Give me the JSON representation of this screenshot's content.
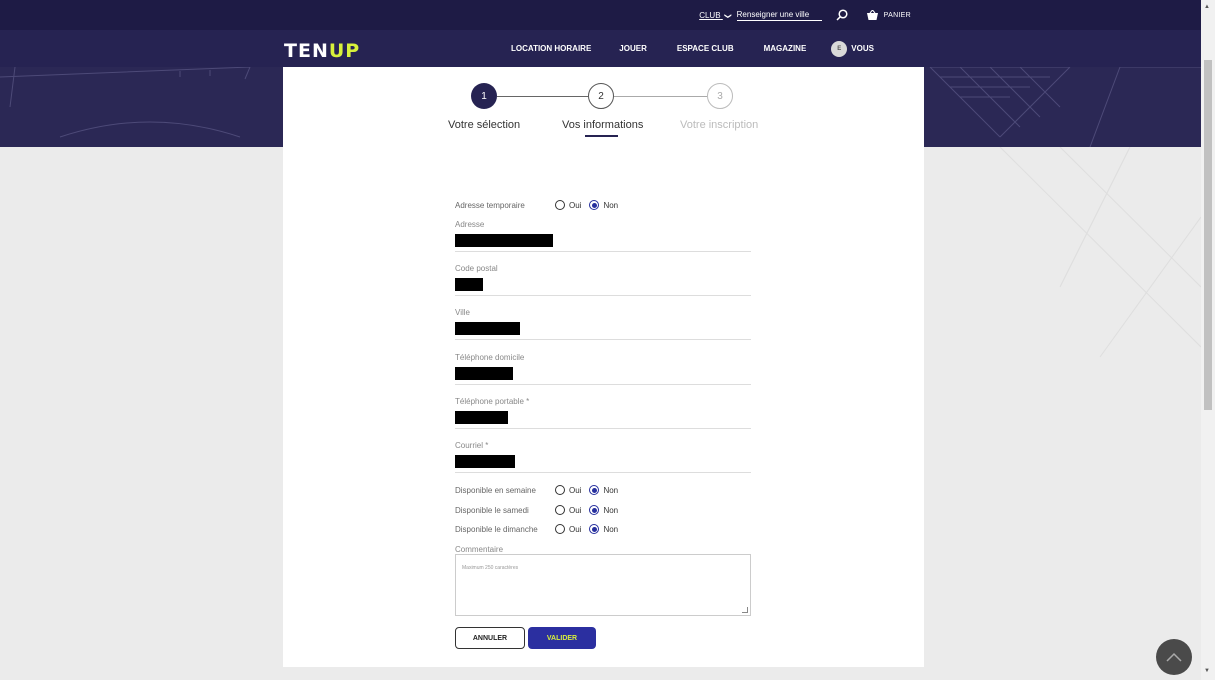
{
  "topbar": {
    "club_label": "CLUB",
    "club_chevron": "❯",
    "city_placeholder": "Renseigner une ville",
    "basket_label": "PANIER",
    "icons": [
      "chevron-down-icon",
      "search-icon",
      "basket-icon"
    ]
  },
  "navbar": {
    "logo_a": "TEN",
    "logo_b": "UP",
    "items": [
      "LOCATION HORAIRE",
      "JOUER",
      "ESPACE CLUB",
      "MAGAZINE"
    ],
    "user_initial": "E",
    "user_label": "VOUS"
  },
  "stepper": {
    "steps": [
      {
        "number": "1",
        "label": "Votre sélection",
        "state": "done"
      },
      {
        "number": "2",
        "label": "Vos informations",
        "state": "active"
      },
      {
        "number": "3",
        "label": "Votre inscription",
        "state": "pending"
      }
    ]
  },
  "form": {
    "temp_address": {
      "label": "Adresse temporaire",
      "selected": "Non"
    },
    "radio_options": [
      "Oui",
      "Non"
    ],
    "fields": [
      {
        "label": "Adresse",
        "redacted": true
      },
      {
        "label": "Code postal",
        "redacted": true
      },
      {
        "label": "Ville",
        "redacted": true
      },
      {
        "label": "Téléphone domicile",
        "redacted": true
      },
      {
        "label": "Téléphone portable *",
        "redacted": true
      },
      {
        "label": "Courriel *",
        "redacted": true
      }
    ],
    "availability": [
      {
        "label": "Disponible en semaine",
        "selected": "Non"
      },
      {
        "label": "Disponible le samedi",
        "selected": "Non"
      },
      {
        "label": "Disponible le dimanche",
        "selected": "Non"
      }
    ],
    "comment_label": "Commentaire",
    "comment_placeholder": "Maximum 250 caractères",
    "cancel_label": "ANNULER",
    "submit_label": "VALIDER"
  },
  "colors": {
    "header_dark": "#1e1b45",
    "nav": "#262352",
    "accent_yellow": "#d8f13b",
    "button_blue": "#2b2fa0",
    "radio_blue": "#262f9e"
  }
}
